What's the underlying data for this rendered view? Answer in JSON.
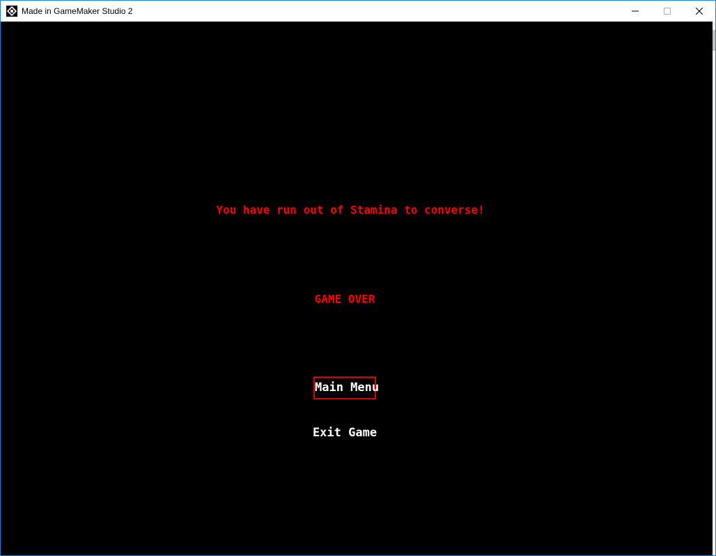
{
  "window": {
    "title": "Made in GameMaker Studio 2",
    "app_icon": "gamemaker-logo-icon",
    "controls": {
      "minimize_icon": "minimize-icon",
      "maximize_icon": "maximize-icon",
      "close_icon": "close-icon"
    }
  },
  "game": {
    "message": "You have run out of Stamina to converse!",
    "heading": "GAME OVER",
    "menu": [
      {
        "label": "Main Menu",
        "selected": true
      },
      {
        "label": "Exit Game",
        "selected": false
      }
    ]
  },
  "colors": {
    "background": "#000000",
    "message_text": "#ff0000",
    "menu_text": "#ffffff",
    "selection_border": "#e00000",
    "window_border": "#1883d7"
  }
}
